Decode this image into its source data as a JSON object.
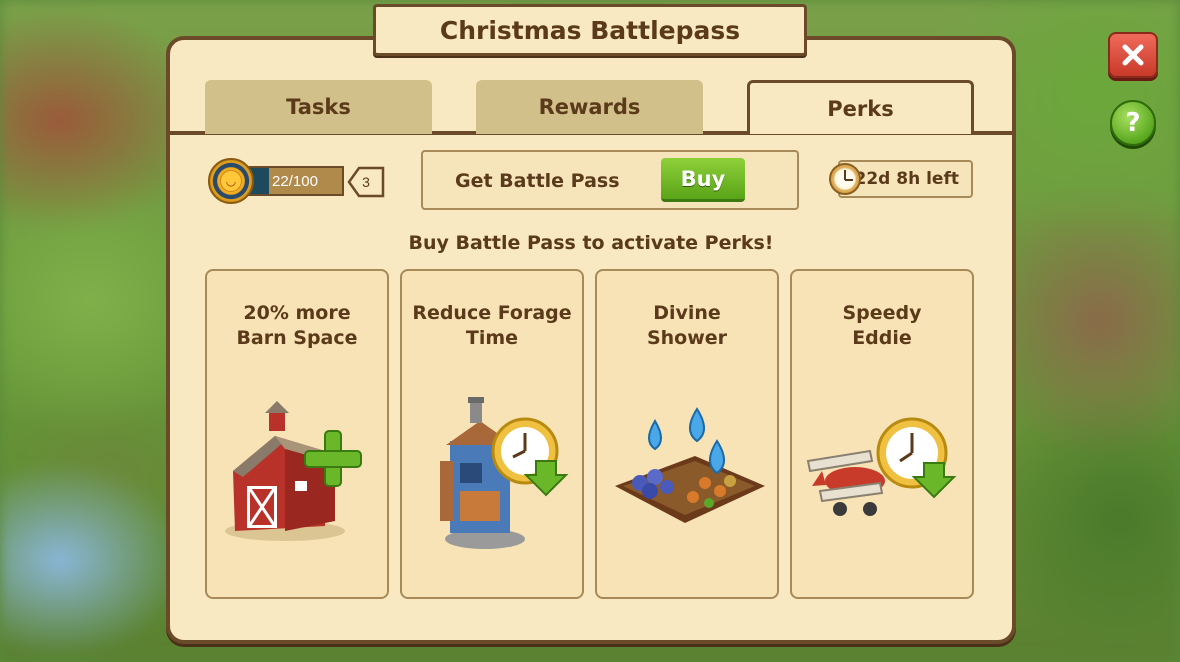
{
  "window": {
    "title": "Christmas Battlepass"
  },
  "tabs": [
    {
      "label": "Tasks",
      "active": false
    },
    {
      "label": "Rewards",
      "active": false
    },
    {
      "label": "Perks",
      "active": true
    }
  ],
  "progress": {
    "xp_text": "22/100",
    "xp_fraction": 0.22,
    "tier": "3"
  },
  "battle_pass": {
    "label": "Get Battle Pass",
    "buy_label": "Buy"
  },
  "timer": {
    "text": "22d 8h left"
  },
  "notice": "Buy Battle Pass to activate Perks!",
  "perks": [
    {
      "title": "20% more\nBarn Space",
      "icon": "barn-plus-icon"
    },
    {
      "title": "Reduce Forage\nTime",
      "icon": "forage-hut-clock-icon"
    },
    {
      "title": "Divine\nShower",
      "icon": "rain-drops-field-icon"
    },
    {
      "title": "Speedy\nEddie",
      "icon": "biplane-clock-icon"
    }
  ],
  "colors": {
    "panel_bg": "#f8e9c2",
    "panel_border": "#6b4a2a",
    "text": "#5a3a1a",
    "buy_green": "#5aa418",
    "close_red": "#c83a2a",
    "help_green": "#5aa820"
  }
}
